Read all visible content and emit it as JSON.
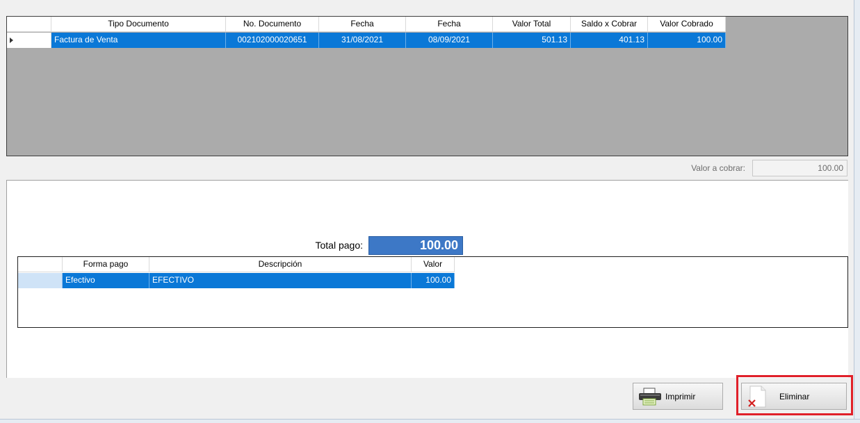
{
  "documents_grid": {
    "columns": [
      "Tipo Documento",
      "No. Documento",
      "Fecha",
      "Fecha",
      "Valor Total",
      "Saldo x Cobrar",
      "Valor Cobrado"
    ],
    "rows": [
      {
        "tipo": "Factura de Venta",
        "numero": "002102000020651",
        "fecha1": "31/08/2021",
        "fecha2": "08/09/2021",
        "valor_total": "501.13",
        "saldo": "401.13",
        "valor_cobrado": "100.00"
      }
    ]
  },
  "valor_a_cobrar": {
    "label": "Valor a cobrar:",
    "value": "100.00"
  },
  "total_pago": {
    "label": "Total pago:",
    "value": "100.00"
  },
  "payments_grid": {
    "columns": [
      "Forma pago",
      "Descripción",
      "Valor"
    ],
    "rows": [
      {
        "forma": "Efectivo",
        "descripcion": "EFECTIVO",
        "valor": "100.00"
      }
    ]
  },
  "buttons": {
    "print_label": "Imprimir",
    "delete_label": "Eliminar"
  },
  "icons": {
    "print": "printer-icon",
    "delete": "delete-document-icon",
    "row_pointer": "row-pointer-icon"
  },
  "colors": {
    "selection": "#0a78d7",
    "total_box": "#3d78c6",
    "highlight": "#e0202a"
  }
}
